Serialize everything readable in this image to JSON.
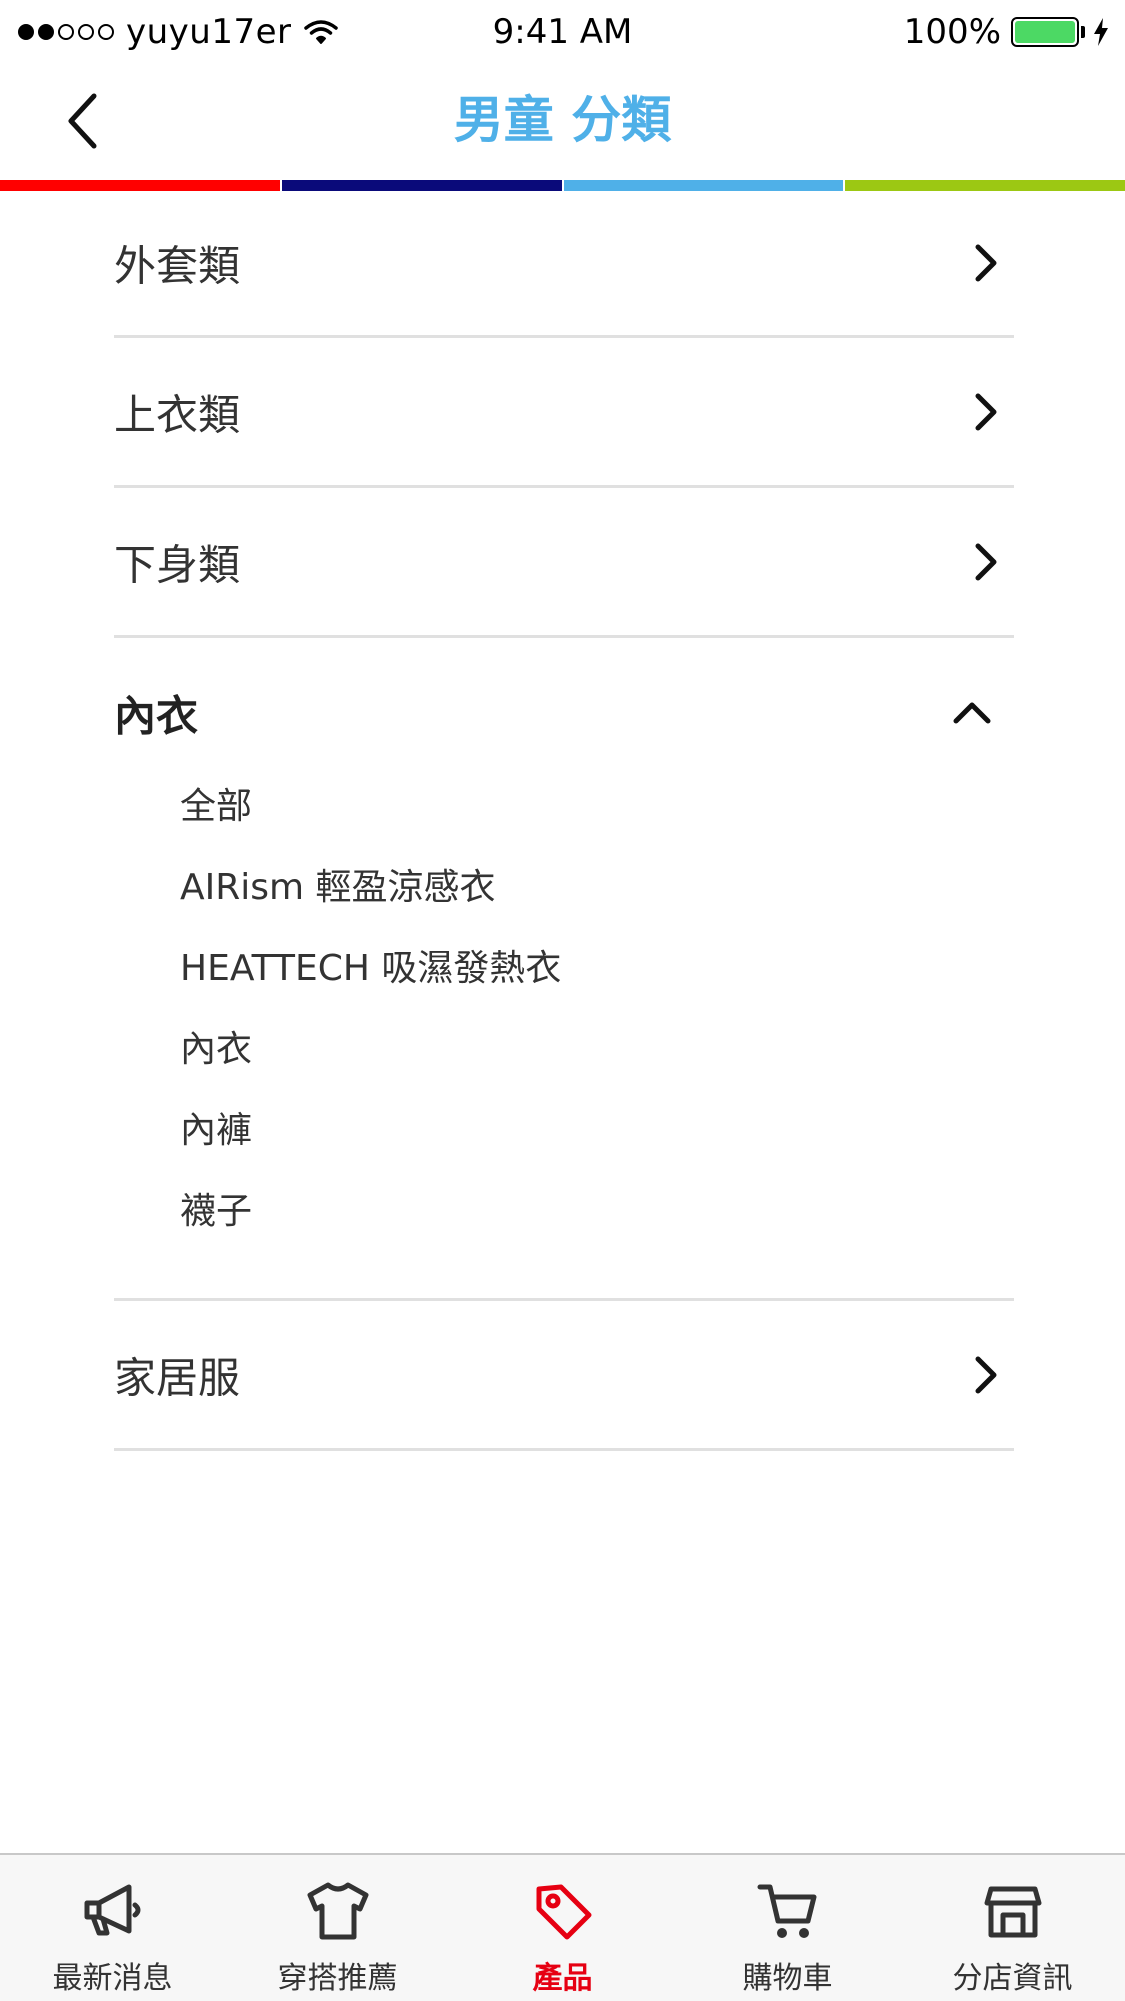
{
  "status_bar": {
    "carrier": "yuyu17er",
    "time": "9:41 AM",
    "battery": "100%"
  },
  "nav": {
    "title": "男童 分類",
    "back_icon": "chevron-left-icon"
  },
  "colors": {
    "title": "#4fb0e8",
    "strip": [
      "#ff0000",
      "#0a0a7a",
      "#4fb0e8",
      "#9cc813"
    ],
    "active_tab": "#e60012",
    "battery": "#4cd964"
  },
  "categories": [
    {
      "label": "外套類",
      "expanded": false
    },
    {
      "label": "上衣類",
      "expanded": false
    },
    {
      "label": "下身類",
      "expanded": false
    },
    {
      "label": "內衣",
      "expanded": true,
      "children": [
        "全部",
        "AIRism 輕盈涼感衣",
        "HEATTECH 吸濕發熱衣",
        "內衣",
        "內褲",
        "襪子"
      ]
    },
    {
      "label": "家居服",
      "expanded": false
    }
  ],
  "tabs": [
    {
      "label": "最新消息",
      "icon": "megaphone-icon",
      "active": false
    },
    {
      "label": "穿搭推薦",
      "icon": "tshirt-icon",
      "active": false
    },
    {
      "label": "產品",
      "icon": "tag-icon",
      "active": true
    },
    {
      "label": "購物車",
      "icon": "cart-icon",
      "active": false
    },
    {
      "label": "分店資訊",
      "icon": "store-icon",
      "active": false
    }
  ]
}
